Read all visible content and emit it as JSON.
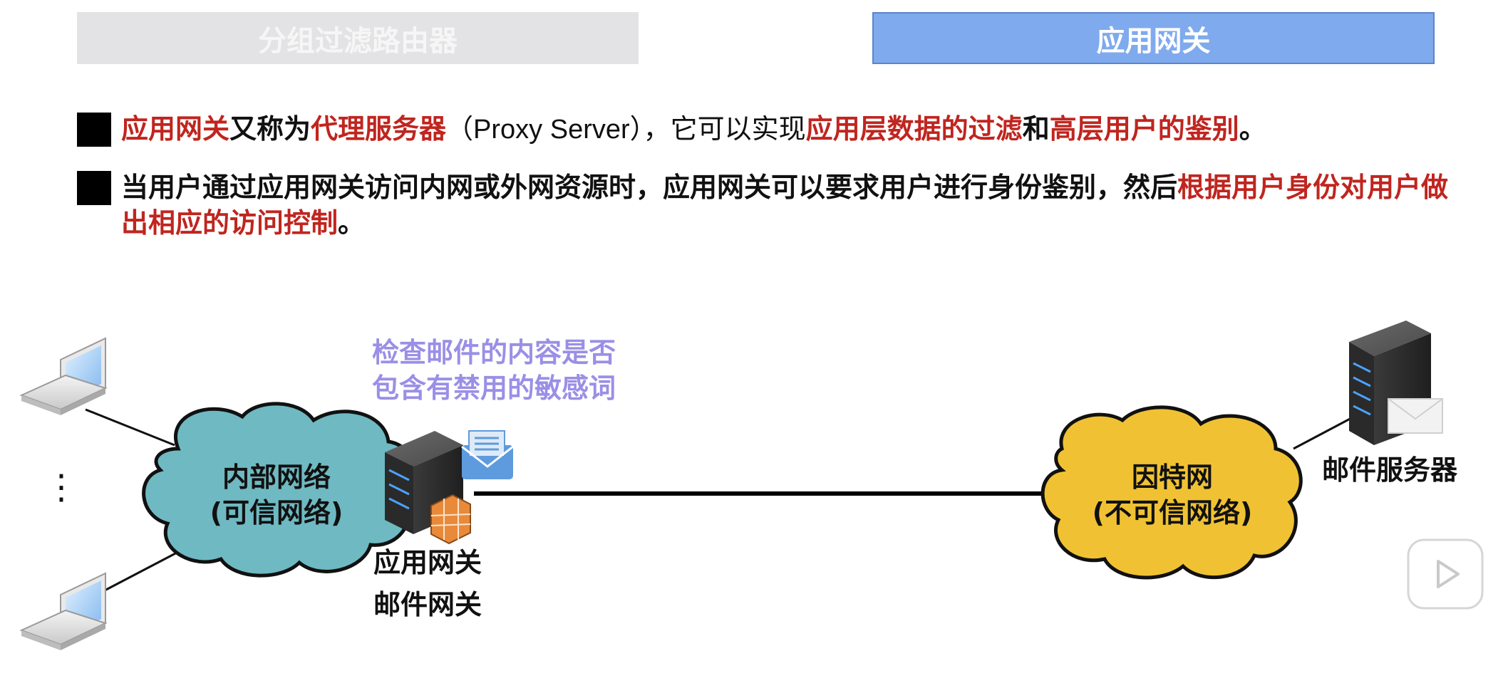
{
  "tabs": {
    "packet_filter": "分组过滤路由器",
    "app_gateway": "应用网关"
  },
  "bullet1": {
    "t1": "应用网关",
    "t2": "又称为",
    "t3": "代理服务器",
    "t4": "（Proxy Server），它可以实现",
    "t5": "应用层数据的过滤",
    "t6": "和",
    "t7": "高层用户的鉴别",
    "t8": "。"
  },
  "bullet2": {
    "t1": "当用户通过应用网关访问内网或外网资源时，应用网关可以要求用户进行身份鉴别，然后",
    "t2": "根据用户身份对用户做出相应的访问控制",
    "t3": "。"
  },
  "diagram": {
    "inner_network_line1": "内部网络",
    "inner_network_line2": "(可信网络)",
    "internet_line1": "因特网",
    "internet_line2": "(不可信网络)",
    "gateway_line1": "应用网关",
    "gateway_line2": "邮件网关",
    "mail_server": "邮件服务器",
    "note_line1": "检查邮件的内容是否",
    "note_line2": "包含有禁用的敏感词",
    "vertical_ellipsis": "⋮"
  },
  "colors": {
    "highlight_red": "#c0251f",
    "note_purple": "#9a8fe6",
    "inner_cloud": "#6fb9c2",
    "internet_cloud": "#f0c233",
    "active_tab": "#7faaee",
    "inactive_tab": "#e3e3e6"
  },
  "icons": [
    "laptop-icon",
    "server-icon",
    "firewall-icon",
    "envelope-icon",
    "play-icon"
  ]
}
